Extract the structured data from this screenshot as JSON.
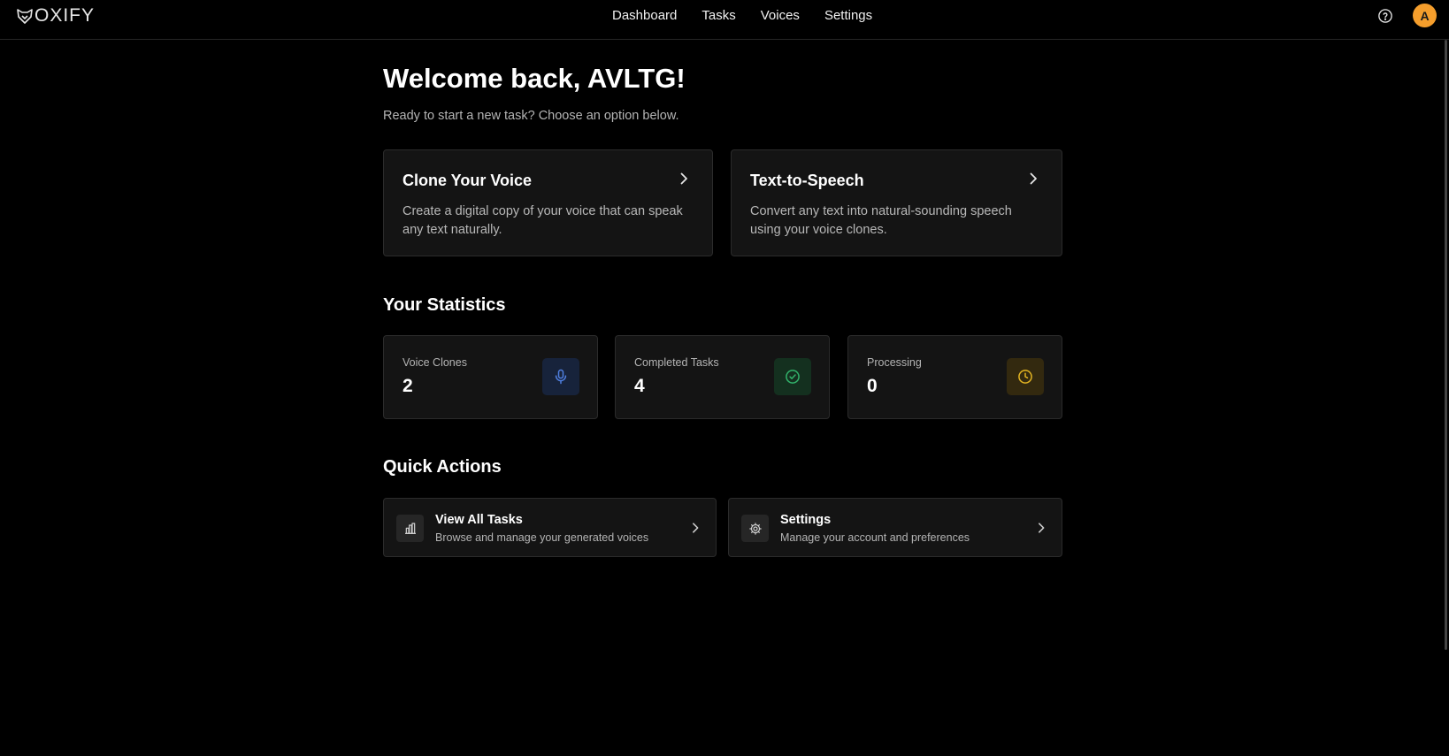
{
  "app": {
    "logo_text": "OXIFY",
    "logo_icon": "fox-head-icon"
  },
  "nav": {
    "items": [
      {
        "label": "Dashboard"
      },
      {
        "label": "Tasks"
      },
      {
        "label": "Voices"
      },
      {
        "label": "Settings"
      }
    ]
  },
  "header": {
    "help_icon": "help-circle-icon",
    "avatar_initial": "A",
    "avatar_color": "#f59e2c"
  },
  "welcome": {
    "title": "Welcome back, AVLTG!",
    "subtitle": "Ready to start a new task? Choose an option below."
  },
  "options": [
    {
      "title": "Clone Your Voice",
      "description": "Create a digital copy of your voice that can speak any text naturally."
    },
    {
      "title": "Text-to-Speech",
      "description": "Convert any text into natural-sounding speech using your voice clones."
    }
  ],
  "statistics": {
    "title": "Your Statistics",
    "items": [
      {
        "label": "Voice Clones",
        "value": "2",
        "icon": "microphone-icon",
        "color": "#4f7fe0",
        "bg": "#17233b"
      },
      {
        "label": "Completed Tasks",
        "value": "4",
        "icon": "check-circle-icon",
        "color": "#32b36b",
        "bg": "#14301f"
      },
      {
        "label": "Processing",
        "value": "0",
        "icon": "clock-icon",
        "color": "#e3b422",
        "bg": "#33290f"
      }
    ]
  },
  "quick_actions": {
    "title": "Quick Actions",
    "items": [
      {
        "title": "View All Tasks",
        "description": "Browse and manage your generated voices",
        "icon": "bar-chart-icon"
      },
      {
        "title": "Settings",
        "description": "Manage your account and preferences",
        "icon": "gear-icon"
      }
    ]
  }
}
